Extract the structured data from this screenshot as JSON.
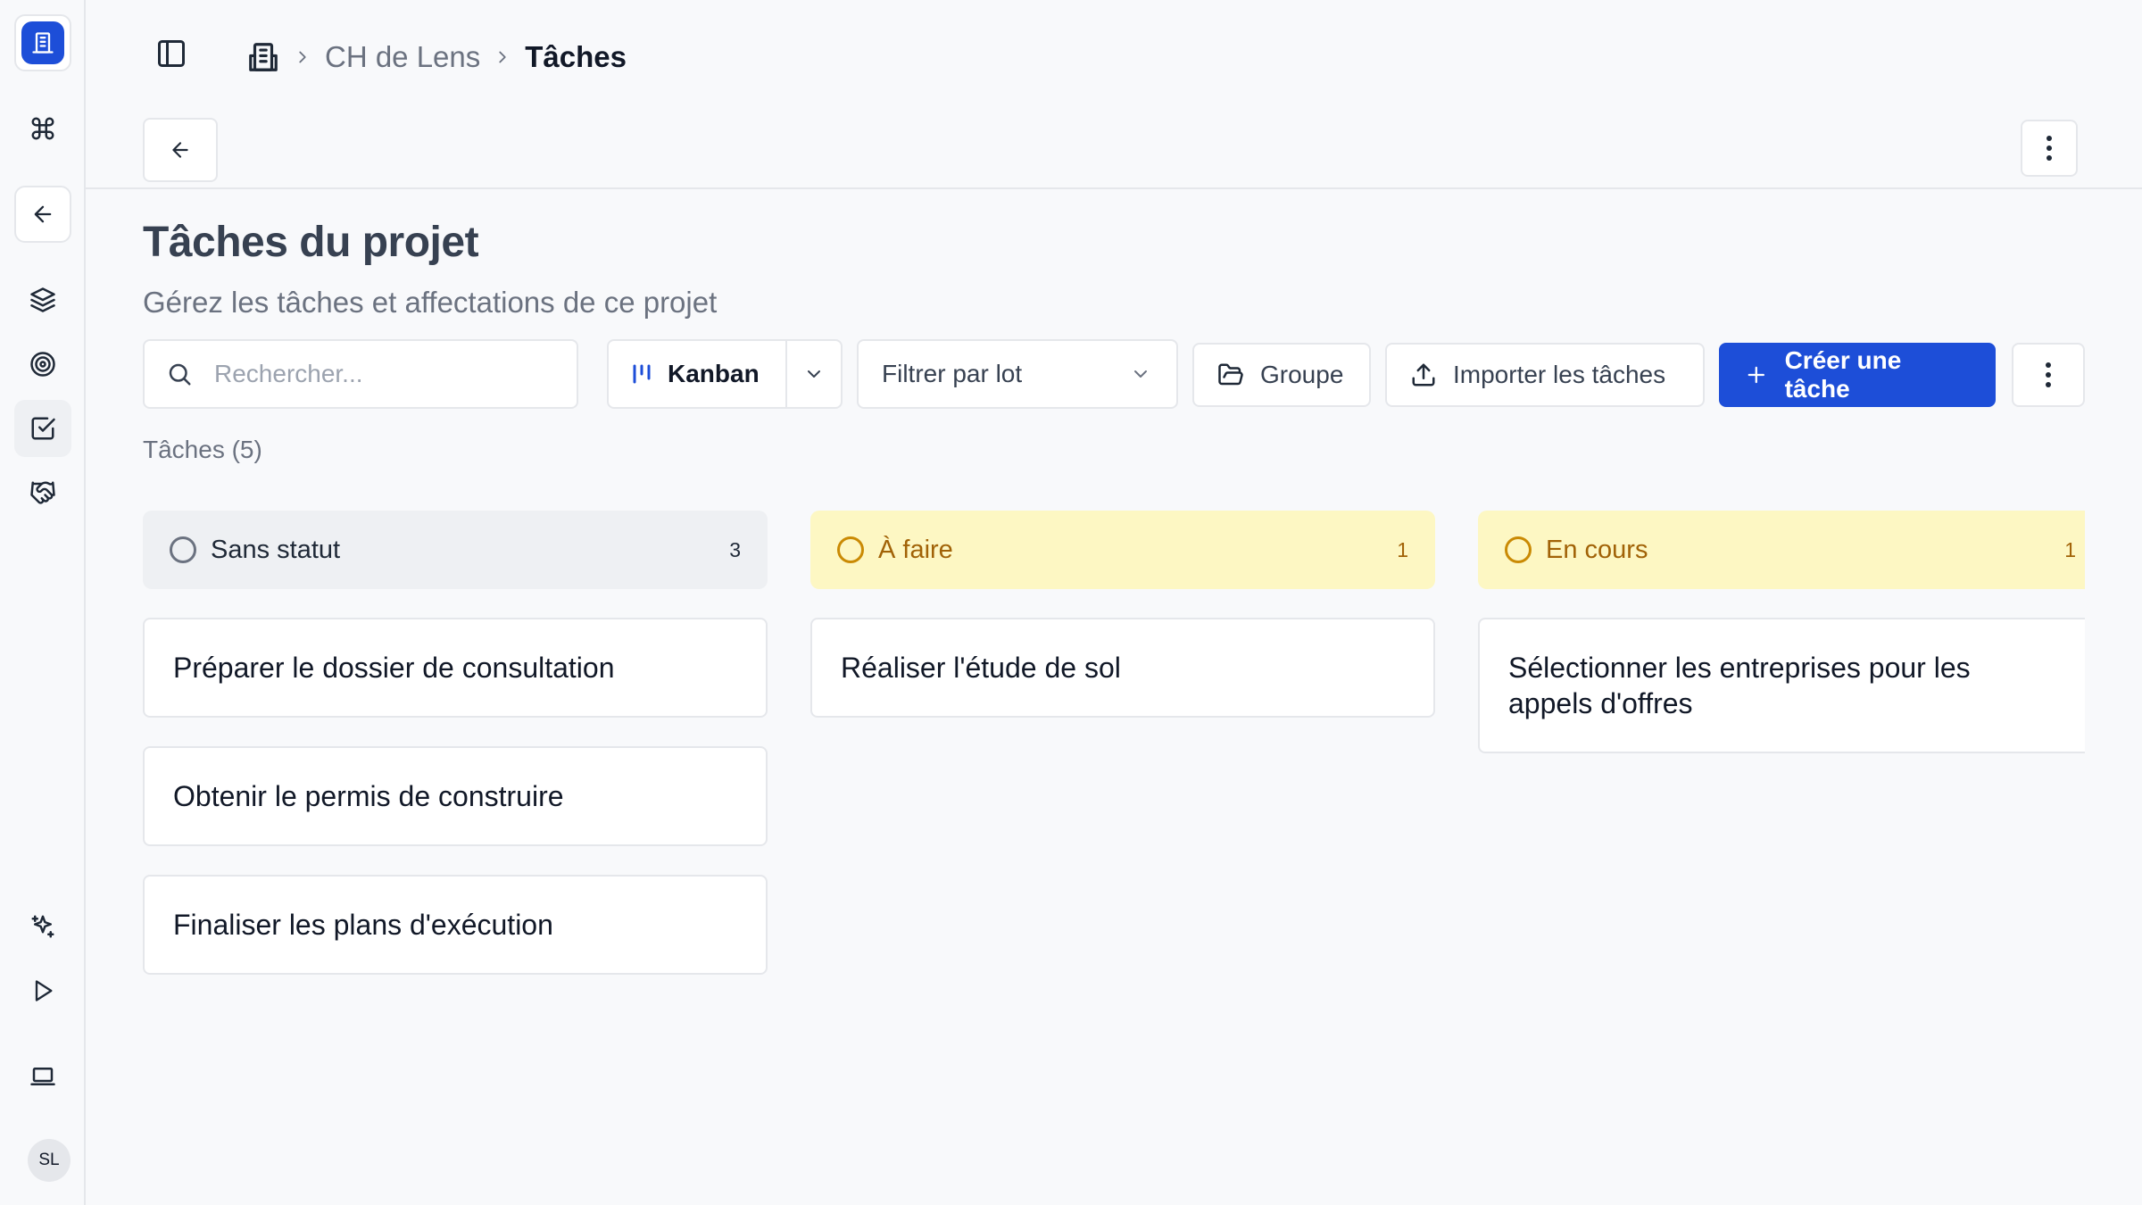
{
  "sidebar": {
    "icons": [
      "building-icon",
      "command-icon",
      "arrow-left-icon",
      "layers-icon",
      "target-icon",
      "check-square-icon",
      "handshake-icon",
      "sparkles-icon",
      "play-icon",
      "laptop-icon"
    ],
    "avatar_initials": "SL"
  },
  "header": {
    "breadcrumb": {
      "project": "CH de Lens",
      "current": "Tâches"
    }
  },
  "main": {
    "title": "Tâches du projet",
    "subtitle": "Gérez les tâches et affectations de ce projet",
    "search_placeholder": "Rechercher...",
    "view_label": "Kanban",
    "filter_label": "Filtrer par lot",
    "group_label": "Groupe",
    "import_label": "Importer les tâches",
    "create_label": "Créer une tâche",
    "task_count_label": "Tâches (5)"
  },
  "board": {
    "columns": [
      {
        "name": "Sans statut",
        "count": "3",
        "tasks": [
          "Préparer le dossier de consultation",
          "Obtenir le permis de construire",
          "Finaliser les plans d'exécution"
        ]
      },
      {
        "name": "À faire",
        "count": "1",
        "tasks": [
          "Réaliser l'étude de sol"
        ]
      },
      {
        "name": "En cours",
        "count": "1",
        "tasks": [
          "Sélectionner les entreprises pour les appels d'offres"
        ]
      }
    ]
  },
  "colors": {
    "accent": "#1d4ed8",
    "status_neutral_bg": "#eef0f3",
    "status_yellow_bg": "#fdf7c3",
    "status_yellow_text": "#a16207"
  }
}
